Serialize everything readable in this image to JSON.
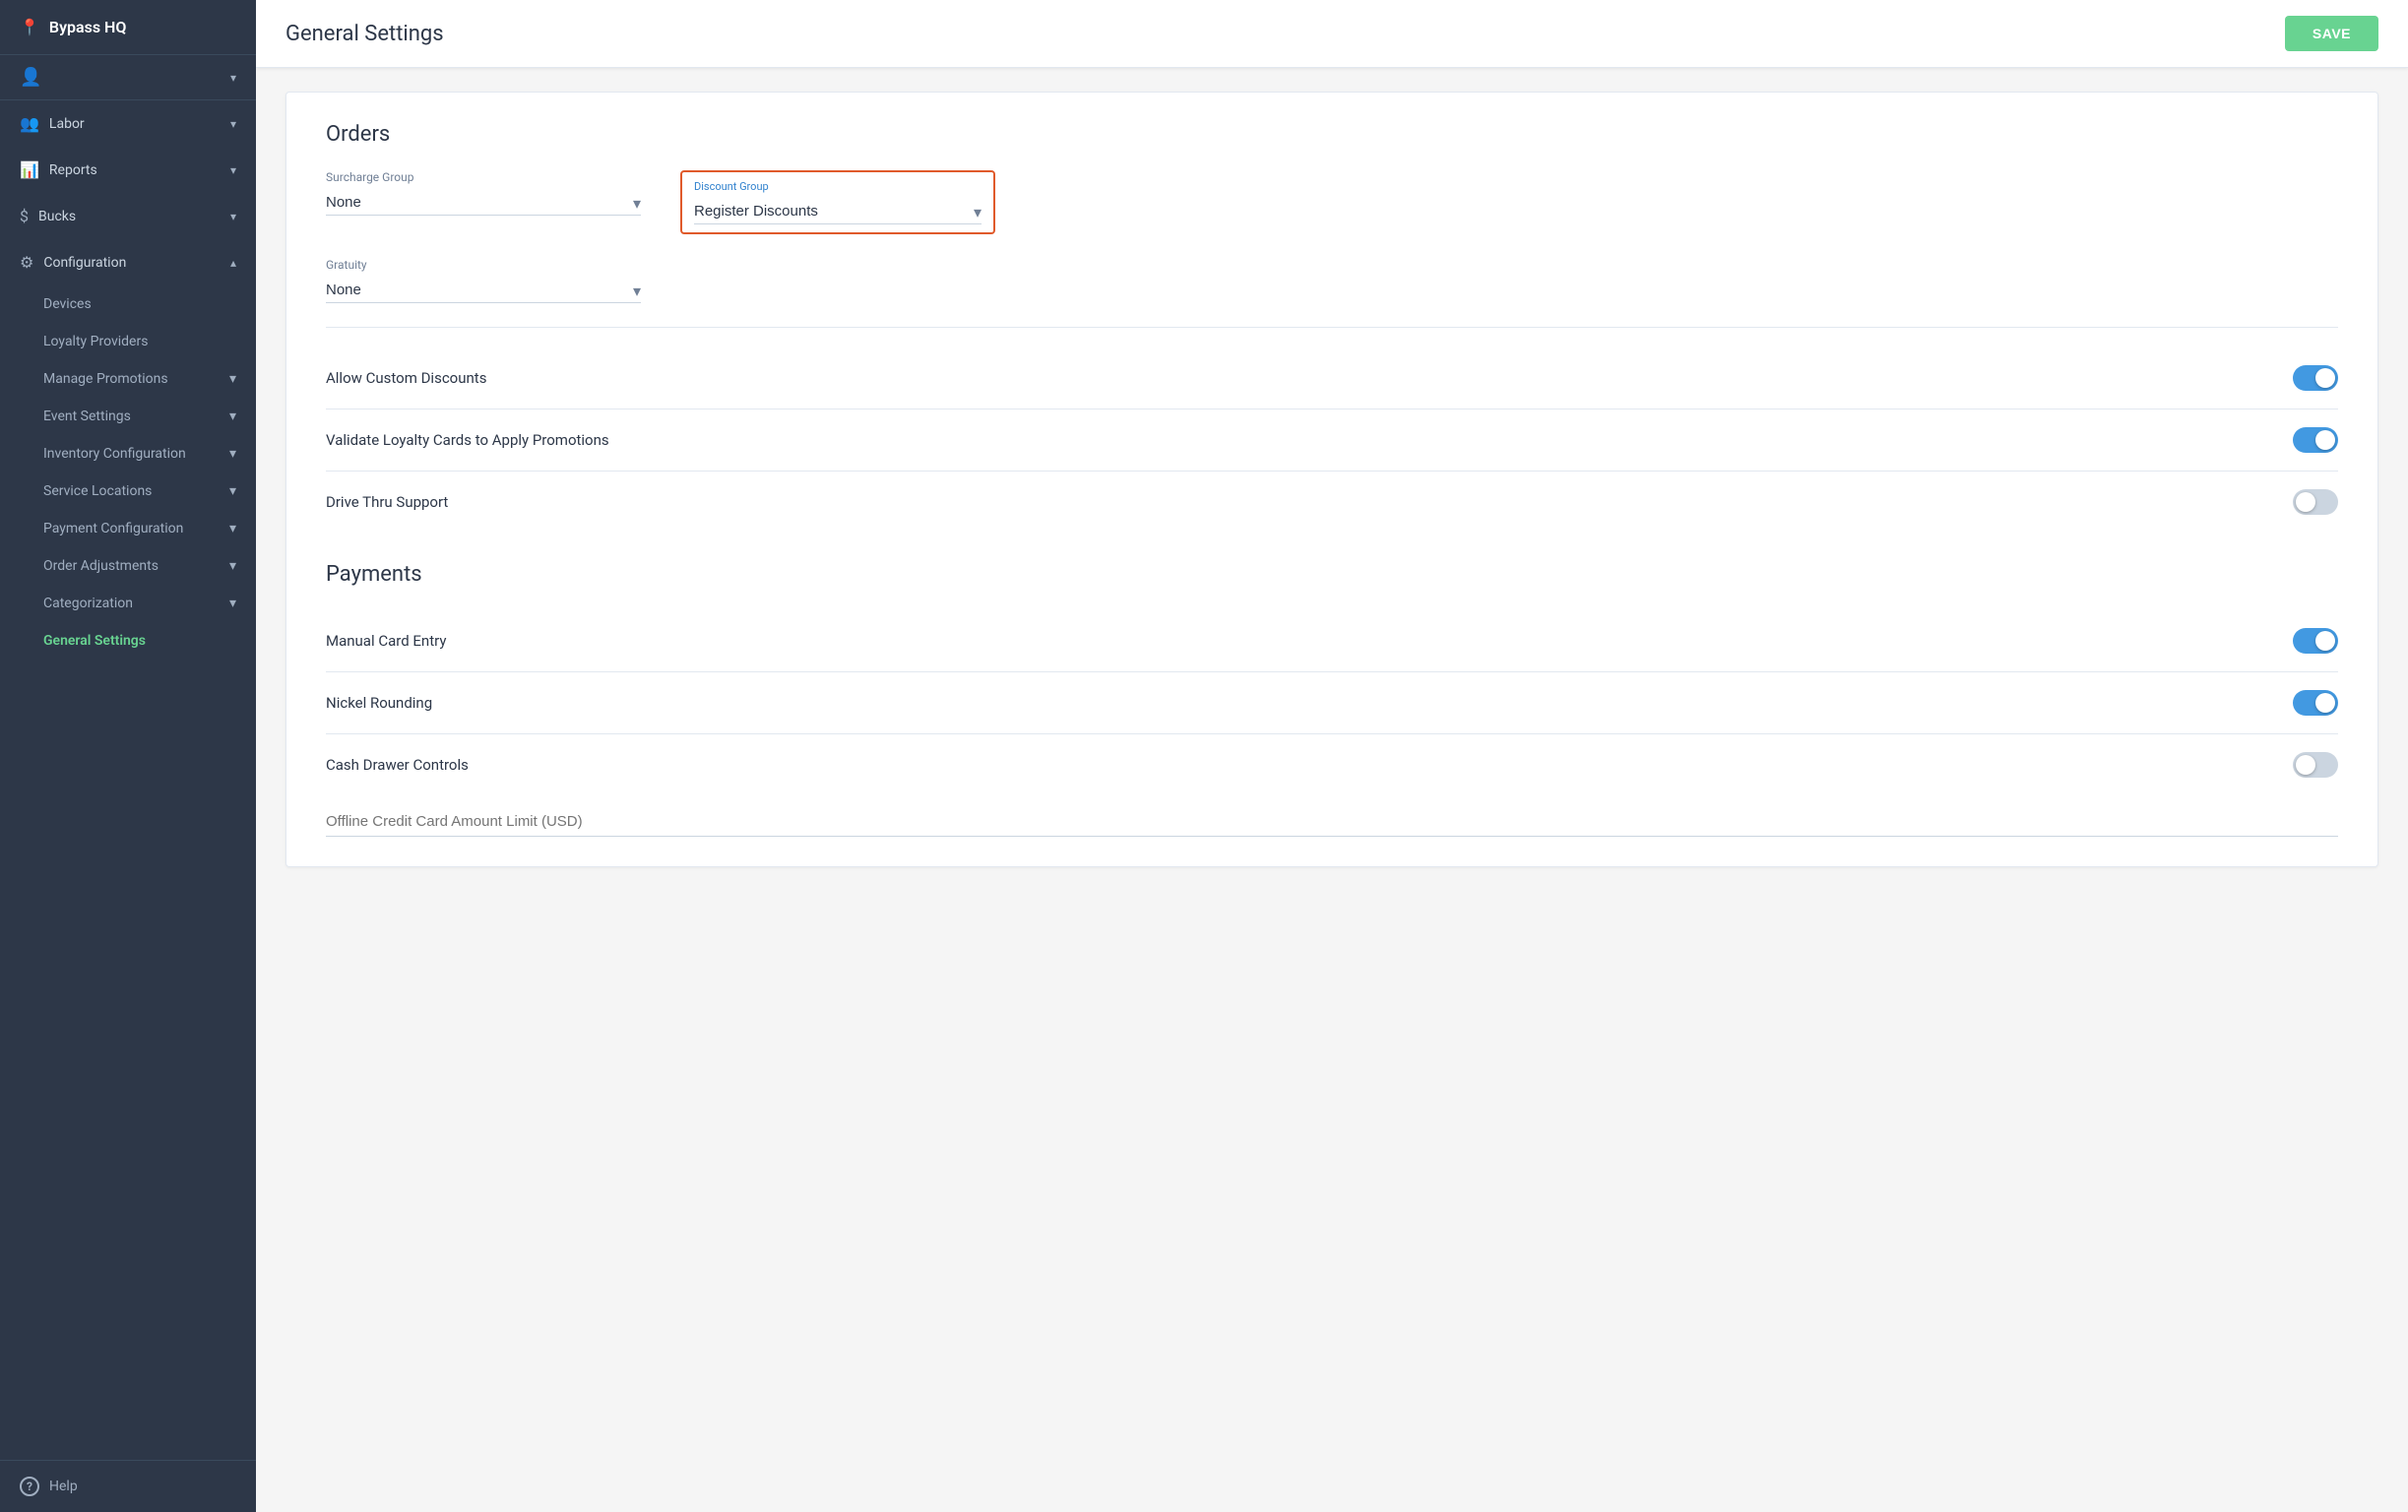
{
  "app": {
    "name": "Bypass HQ",
    "logo_symbol": "📍"
  },
  "sidebar": {
    "user_icon": "👤",
    "nav_items": [
      {
        "id": "labor",
        "label": "Labor",
        "icon": "👥",
        "has_chevron": true
      },
      {
        "id": "reports",
        "label": "Reports",
        "icon": "📊",
        "has_chevron": true
      },
      {
        "id": "bucks",
        "label": "Bucks",
        "icon": "$",
        "has_chevron": true
      },
      {
        "id": "configuration",
        "label": "Configuration",
        "icon": "⚙",
        "has_chevron": true,
        "expanded": true
      }
    ],
    "config_sub_items": [
      {
        "id": "devices",
        "label": "Devices",
        "active": false,
        "has_chevron": false
      },
      {
        "id": "loyalty-providers",
        "label": "Loyalty Providers",
        "active": false,
        "has_chevron": false
      },
      {
        "id": "manage-promotions",
        "label": "Manage Promotions",
        "active": false,
        "has_chevron": true
      },
      {
        "id": "event-settings",
        "label": "Event Settings",
        "active": false,
        "has_chevron": true
      },
      {
        "id": "inventory-configuration",
        "label": "Inventory Configuration",
        "active": false,
        "has_chevron": true
      },
      {
        "id": "service-locations",
        "label": "Service Locations",
        "active": false,
        "has_chevron": true
      },
      {
        "id": "payment-configuration",
        "label": "Payment Configuration",
        "active": false,
        "has_chevron": true
      },
      {
        "id": "order-adjustments",
        "label": "Order Adjustments",
        "active": false,
        "has_chevron": true
      },
      {
        "id": "categorization",
        "label": "Categorization",
        "active": false,
        "has_chevron": true
      },
      {
        "id": "general-settings",
        "label": "General Settings",
        "active": true,
        "has_chevron": false
      }
    ],
    "help_label": "Help"
  },
  "header": {
    "title": "General Settings",
    "save_button": "SAVE"
  },
  "orders_section": {
    "title": "Orders",
    "surcharge_group": {
      "label": "Surcharge Group",
      "value": "None",
      "options": [
        "None"
      ]
    },
    "discount_group": {
      "label": "Discount Group",
      "value": "Register Discounts",
      "options": [
        "Register Discounts"
      ],
      "highlighted": true
    },
    "gratuity": {
      "label": "Gratuity",
      "value": "None",
      "options": [
        "None"
      ]
    },
    "toggles": [
      {
        "id": "allow-custom-discounts",
        "label": "Allow Custom Discounts",
        "on": true
      },
      {
        "id": "validate-loyalty-cards",
        "label": "Validate Loyalty Cards to Apply Promotions",
        "on": true
      },
      {
        "id": "drive-thru-support",
        "label": "Drive Thru Support",
        "on": false
      }
    ]
  },
  "payments_section": {
    "title": "Payments",
    "toggles": [
      {
        "id": "manual-card-entry",
        "label": "Manual Card Entry",
        "on": true
      },
      {
        "id": "nickel-rounding",
        "label": "Nickel Rounding",
        "on": true
      },
      {
        "id": "cash-drawer-controls",
        "label": "Cash Drawer Controls",
        "on": false
      }
    ],
    "offline_credit_label": "Offline Credit Card Amount Limit (USD)"
  }
}
